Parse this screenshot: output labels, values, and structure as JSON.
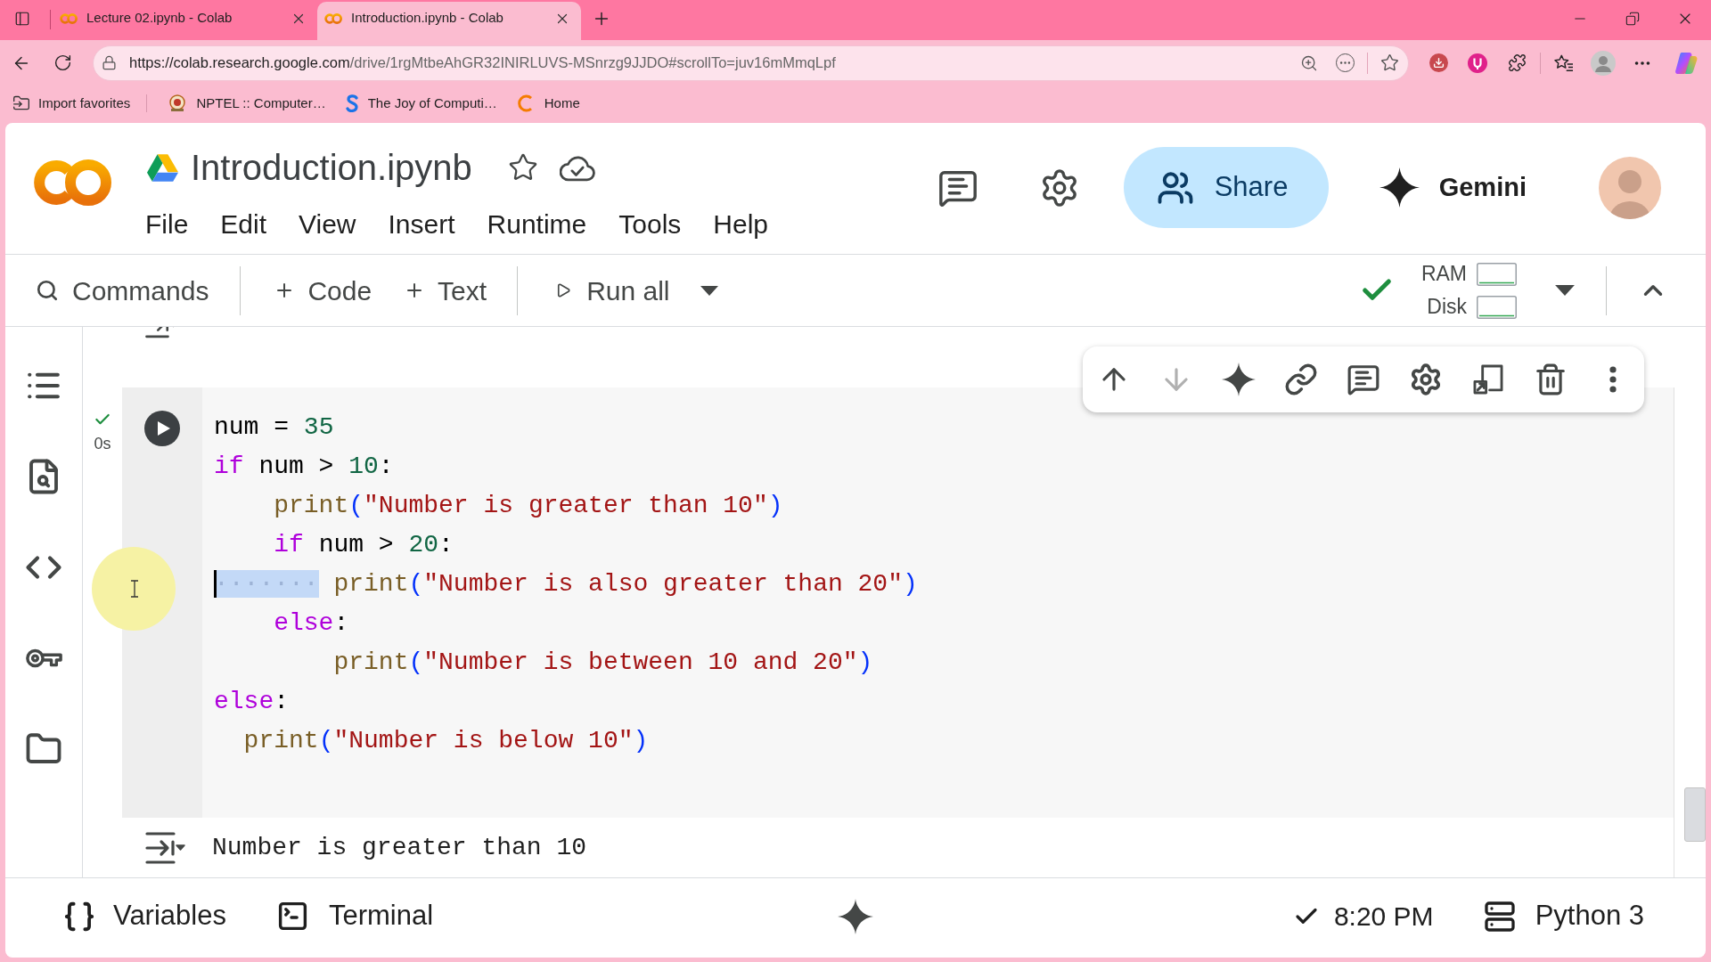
{
  "browser": {
    "tabs": [
      {
        "title": "Lecture 02.ipynb - Colab",
        "selected": false
      },
      {
        "title": "Introduction.ipynb - Colab",
        "selected": true
      }
    ],
    "address": {
      "host": "https://colab.research.google.com",
      "path": "/drive/1rgMtbeAhGR32INIRLUVS-MSnrzg9JJDO#scrollTo=juv16mMmqLpf"
    },
    "bookmarks": [
      {
        "label": "Import favorites",
        "kind": "import"
      },
      {
        "label": "NPTEL :: Computer…",
        "kind": "emblem"
      },
      {
        "label": "The Joy of Computi…",
        "kind": "letter"
      },
      {
        "label": "Home",
        "kind": "ring"
      }
    ]
  },
  "header": {
    "title": "Introduction.ipynb",
    "menu": [
      "File",
      "Edit",
      "View",
      "Insert",
      "Runtime",
      "Tools",
      "Help"
    ],
    "share": "Share",
    "gemini": "Gemini"
  },
  "toolbar": {
    "commands": "Commands",
    "add_code": "Code",
    "add_text": "Text",
    "run_all": "Run all",
    "resources": [
      {
        "label": "RAM"
      },
      {
        "label": "Disk"
      }
    ]
  },
  "cell": {
    "execution_time": "0s",
    "code": [
      [
        {
          "kind": "plain",
          "text": "num = "
        },
        {
          "kind": "number",
          "text": "35"
        }
      ],
      [
        {
          "kind": "keyword",
          "text": "if"
        },
        {
          "kind": "plain",
          "text": " num > "
        },
        {
          "kind": "number",
          "text": "10"
        },
        {
          "kind": "plain",
          "text": ":"
        }
      ],
      [
        {
          "kind": "func",
          "text": "    print"
        },
        {
          "kind": "bracket",
          "text": "("
        },
        {
          "kind": "string",
          "text": "\"Number is greater than 10\""
        },
        {
          "kind": "bracket",
          "text": ")"
        }
      ],
      [
        {
          "kind": "keyword",
          "text": "    if"
        },
        {
          "kind": "plain",
          "text": " num > "
        },
        {
          "kind": "number",
          "text": "20"
        },
        {
          "kind": "plain",
          "text": ":"
        }
      ],
      [
        {
          "kind": "selection",
          "text": "·······"
        },
        {
          "kind": "func",
          "text": " print"
        },
        {
          "kind": "bracket",
          "text": "("
        },
        {
          "kind": "string",
          "text": "\"Number is also greater than 20\""
        },
        {
          "kind": "bracket",
          "text": ")"
        }
      ],
      [
        {
          "kind": "keyword",
          "text": "    else"
        },
        {
          "kind": "plain",
          "text": ":"
        }
      ],
      [
        {
          "kind": "func",
          "text": "        print"
        },
        {
          "kind": "bracket",
          "text": "("
        },
        {
          "kind": "string",
          "text": "\"Number is between 10 and 20\""
        },
        {
          "kind": "bracket",
          "text": ")"
        }
      ],
      [
        {
          "kind": "keyword",
          "text": "else"
        },
        {
          "kind": "plain",
          "text": ":"
        }
      ],
      [
        {
          "kind": "func",
          "text": "  print"
        },
        {
          "kind": "bracket",
          "text": "("
        },
        {
          "kind": "string",
          "text": "\"Number is below 10\""
        },
        {
          "kind": "bracket",
          "text": ")"
        }
      ]
    ],
    "output": "Number is greater than 10"
  },
  "cell_toolbar": [
    {
      "kind": "move_up",
      "disabled": false
    },
    {
      "kind": "move_down",
      "disabled": true
    },
    {
      "kind": "gemini",
      "disabled": false
    },
    {
      "kind": "link",
      "disabled": false
    },
    {
      "kind": "comment",
      "disabled": false
    },
    {
      "kind": "settings",
      "disabled": false
    },
    {
      "kind": "mirror",
      "disabled": false
    },
    {
      "kind": "delete",
      "disabled": false
    },
    {
      "kind": "more",
      "disabled": false
    }
  ],
  "status_bar": {
    "variables": "Variables",
    "terminal": "Terminal",
    "time": "8:20 PM",
    "runtime": "Python 3"
  }
}
